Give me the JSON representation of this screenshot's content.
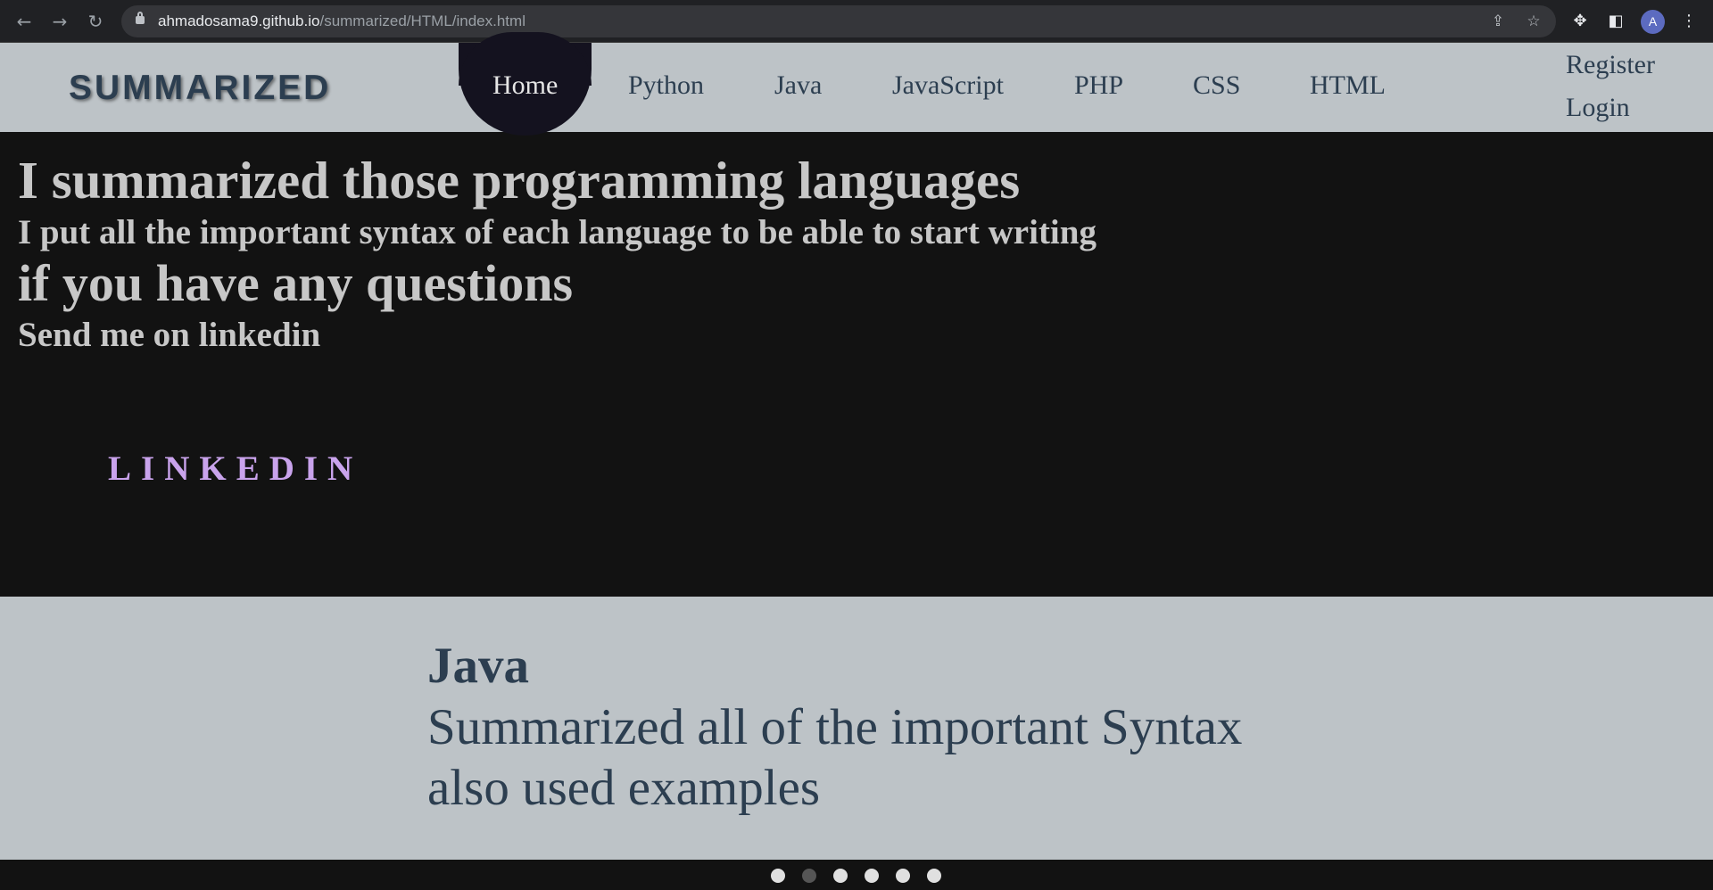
{
  "browser": {
    "url_host": "ahmadosama9.github.io",
    "url_path": "/summarized/HTML/index.html"
  },
  "header": {
    "logo": "SUMMARIZED",
    "nav": [
      "Home",
      "Python",
      "Java",
      "JavaScript",
      "PHP",
      "CSS",
      "HTML"
    ],
    "active_nav": "Home",
    "register": "Register",
    "login": "Login"
  },
  "hero": {
    "title": "I summarized those programming languages",
    "subtitle": "I put all the important syntax of each language to be able to start writing",
    "question": "if you have any questions",
    "send": "Send me on linkedin",
    "linkedin_label": "LINKEDIN"
  },
  "slider": {
    "title": "Java",
    "line1": "Summarized all of the important Syntax",
    "line2": "also used examples",
    "dot_count": 6,
    "active_dot": 2
  },
  "colors": {
    "header_bg": "#bdc3c7",
    "hero_bg": "#121212",
    "nav_text": "#2c3e50",
    "linkedin": "#c9a3ec"
  }
}
